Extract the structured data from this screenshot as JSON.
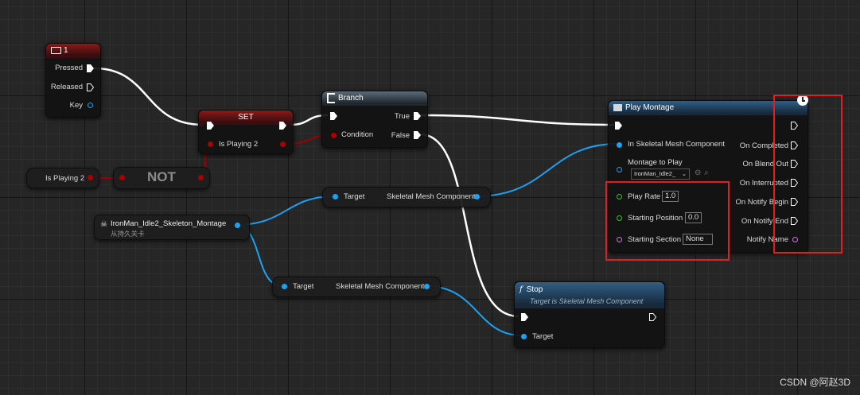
{
  "key_node": {
    "title": "1",
    "pressed": "Pressed",
    "released": "Released",
    "key": "Key"
  },
  "set_node": {
    "title": "SET",
    "var": "Is Playing 2"
  },
  "var_getter": {
    "label": "Is Playing 2"
  },
  "not_node": {
    "label": "NOT"
  },
  "branch_node": {
    "title": "Branch",
    "condition": "Condition",
    "true_label": "True",
    "false_label": "False"
  },
  "montage_asset": {
    "name": "IronMan_Idle2_Skeleton_Montage",
    "subtitle": "从持久关卡"
  },
  "target_node_1": {
    "target": "Target",
    "output": "Skeletal Mesh Component"
  },
  "target_node_2": {
    "target": "Target",
    "output": "Skeletal Mesh Component"
  },
  "play_montage": {
    "title": "Play Montage",
    "in_skel": "In Skeletal Mesh Component",
    "montage_to_play": "Montage to Play",
    "montage_value": "IronMan_Idle2_",
    "play_rate": "Play Rate",
    "play_rate_value": "1.0",
    "start_pos": "Starting Position",
    "start_pos_value": "0.0",
    "start_section": "Starting Section",
    "start_section_value": "None",
    "on_completed": "On Completed",
    "on_blend_out": "On Blend Out",
    "on_interrupted": "On Interrupted",
    "on_notify_begin": "On Notify Begin",
    "on_notify_end": "On Notify End",
    "notify_name": "Notify Name"
  },
  "stop_node": {
    "title": "Stop",
    "subtitle": "Target is Skeletal Mesh Component",
    "target": "Target",
    "icon": "f"
  },
  "watermark": "CSDN @阿赵3D",
  "colors": {
    "exec": "#ffffff",
    "object": "#1da1f2",
    "bool": "#9c0000",
    "float": "#36c62c",
    "name": "#c77dd8",
    "highlight": "#e02020"
  }
}
